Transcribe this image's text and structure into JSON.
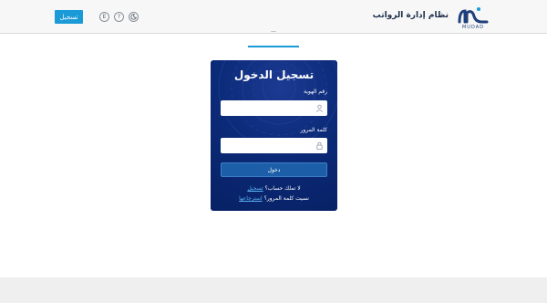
{
  "header": {
    "logo_word": "MUDAD",
    "app_title": "نظام إدارة الرواتب",
    "signup_label": "تسجيل",
    "icons": [
      "theme-toggle-icon",
      "help-icon",
      "language-icon"
    ],
    "language_glyph": "E",
    "help_glyph": "?",
    "accent_color": "#1a9ad6"
  },
  "tabs": {
    "partial_label": "..."
  },
  "login": {
    "title": "تسجيل الدخول",
    "id_label": "رقم الهوية",
    "id_value": "",
    "password_label": "كلمة المرور",
    "password_value": "",
    "submit_label": "دخول",
    "no_account_text": "لا تملك حساب؟",
    "signup_link": "تسجيل",
    "forgot_text": "نسيت كلمة المرور؟",
    "recover_link": "استرجاعها",
    "card_color": "#0b2a78"
  }
}
